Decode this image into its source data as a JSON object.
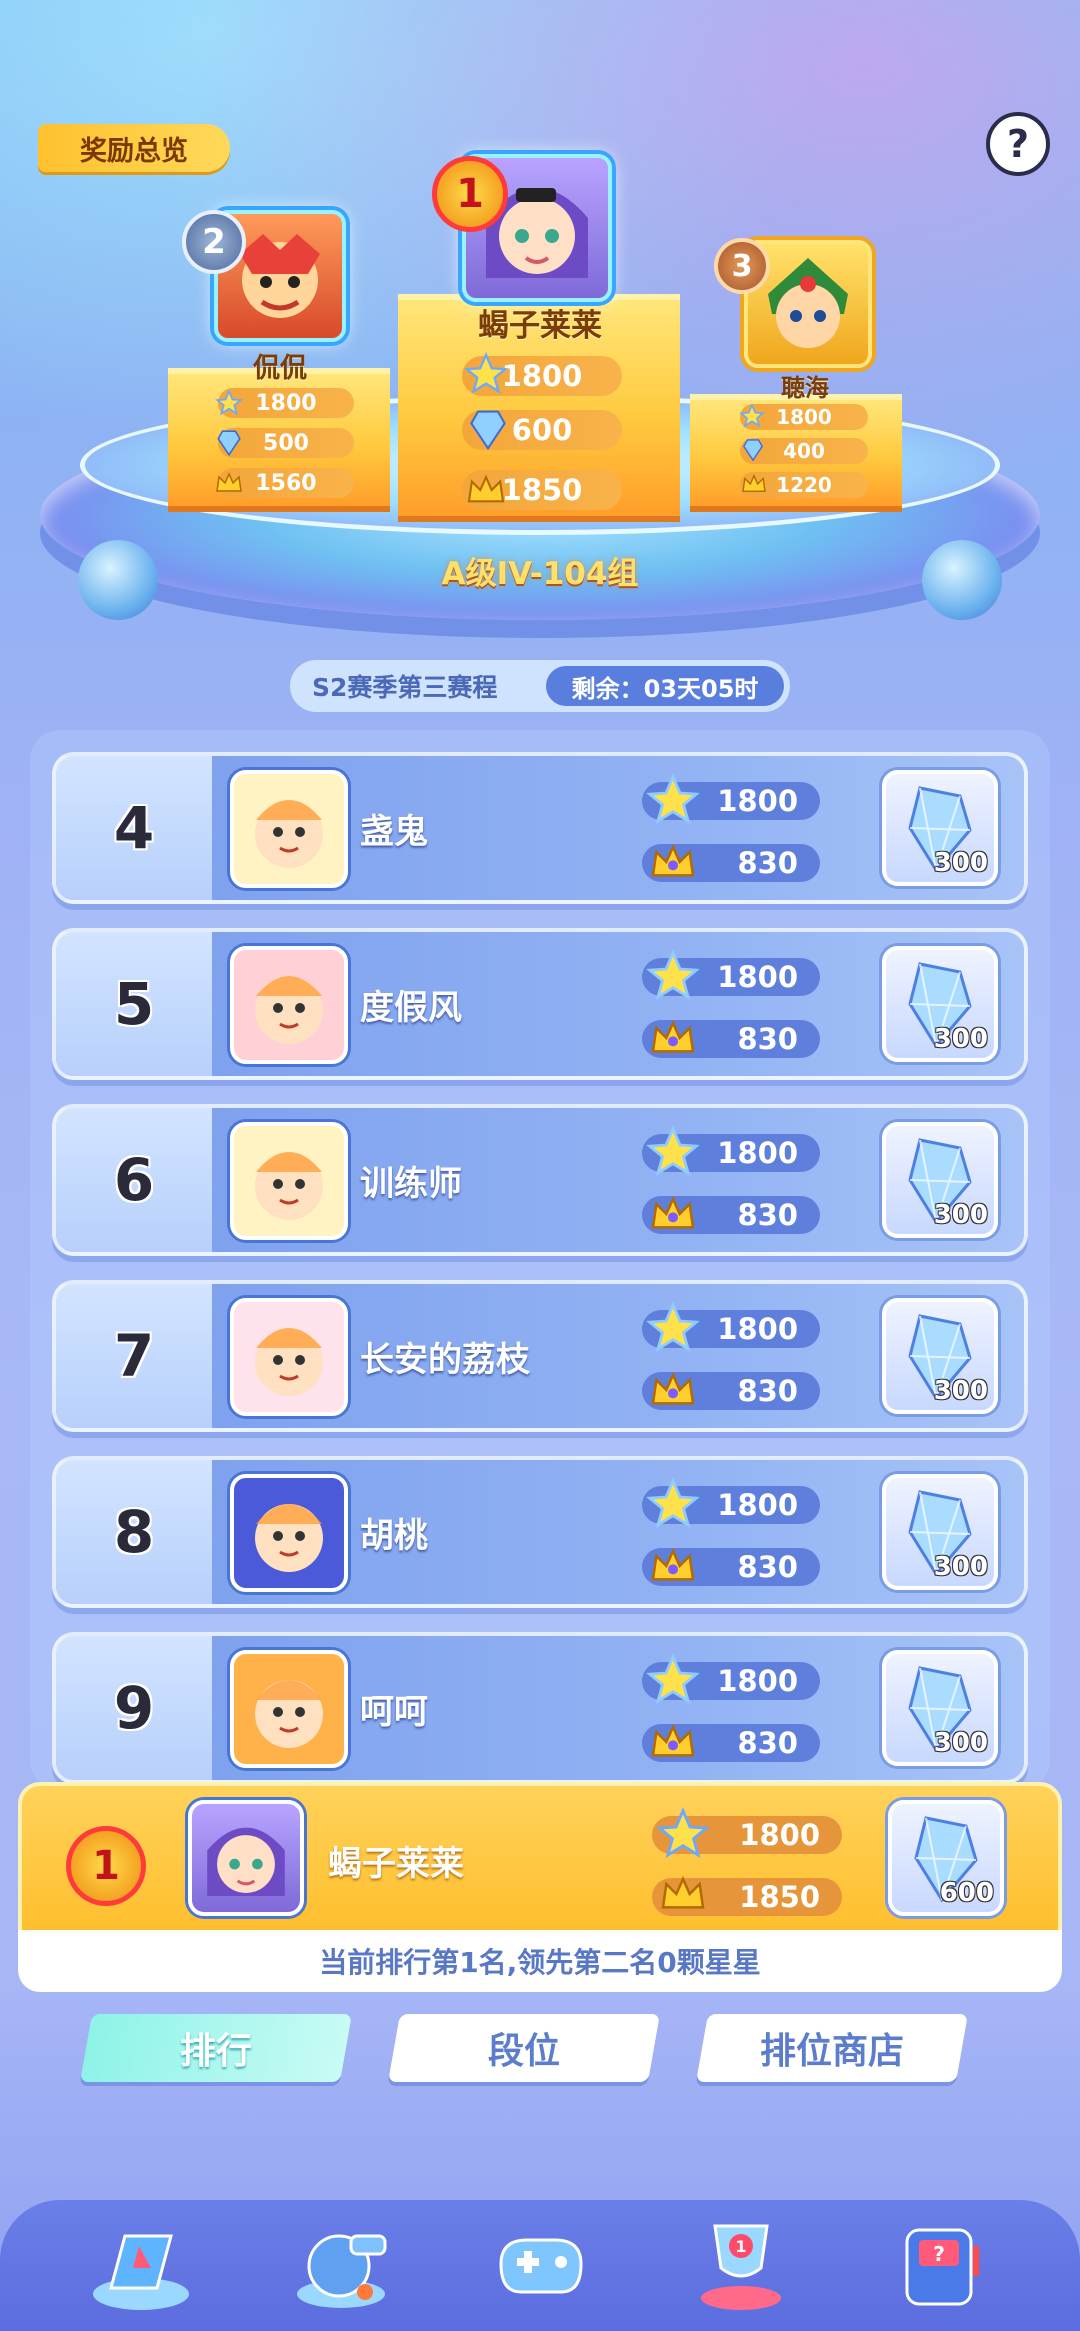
{
  "header": {
    "reward_overview": "奖励总览",
    "help_symbol": "?"
  },
  "podium": {
    "group_title": "A级IV-104组",
    "first": {
      "rank": "1",
      "name": "蝎子莱莱",
      "stars": "1800",
      "gems": "600",
      "crowns": "1850"
    },
    "second": {
      "rank": "2",
      "name": "侃侃",
      "stars": "1800",
      "gems": "500",
      "crowns": "1560"
    },
    "third": {
      "rank": "3",
      "name": "聴海",
      "stars": "1800",
      "gems": "400",
      "crowns": "1220"
    }
  },
  "season": {
    "name": "S2赛季第三赛程",
    "remaining": "剩余：03天05时"
  },
  "ranking_list": [
    {
      "rank": "4",
      "name": "盏鬼",
      "stars": "1800",
      "crowns": "830",
      "reward": "300"
    },
    {
      "rank": "5",
      "name": "度假风",
      "stars": "1800",
      "crowns": "830",
      "reward": "300"
    },
    {
      "rank": "6",
      "name": "训练师",
      "stars": "1800",
      "crowns": "830",
      "reward": "300"
    },
    {
      "rank": "7",
      "name": "长安的荔枝",
      "stars": "1800",
      "crowns": "830",
      "reward": "300"
    },
    {
      "rank": "8",
      "name": "胡桃",
      "stars": "1800",
      "crowns": "830",
      "reward": "300"
    },
    {
      "rank": "9",
      "name": "呵呵",
      "stars": "1800",
      "crowns": "830",
      "reward": "300"
    }
  ],
  "my_rank": {
    "rank": "1",
    "name": "蝎子莱莱",
    "stars": "1800",
    "crowns": "1850",
    "reward": "600",
    "tip": "当前排行第1名,领先第二名0颗星星"
  },
  "tabs": [
    {
      "label": "排行",
      "active": true
    },
    {
      "label": "段位",
      "active": false
    },
    {
      "label": "排位商店",
      "active": false
    }
  ],
  "bottom_nav": [
    {
      "icon": "adventure-icon"
    },
    {
      "icon": "whistle-icon"
    },
    {
      "icon": "gamepad-icon"
    },
    {
      "icon": "trophy-icon"
    },
    {
      "icon": "mystery-machine-icon"
    }
  ],
  "colors": {
    "accent_gold": "#ffc12e",
    "row_blue": "#7fa2ee",
    "stat_pill": "#5e7fdc",
    "tab_active": "#8ef3e7"
  }
}
